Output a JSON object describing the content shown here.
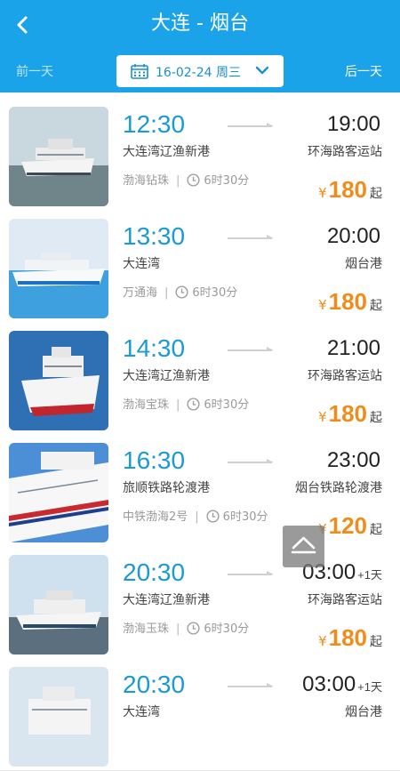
{
  "header": {
    "title": "大连 - 烟台",
    "prev_day": "前一天",
    "next_day": "后一天",
    "date": "16-02-24 周三"
  },
  "colors": {
    "brand": "#1aa3e8",
    "time": "#1a9ad6",
    "price": "#f08c1b"
  },
  "sailings": [
    {
      "depart": "12:30",
      "from": "大连湾辽渔新港",
      "ship": "渤海钻珠",
      "duration": "6时30分",
      "arrive": "19:00",
      "next_day": "",
      "to": "环海路客运站",
      "currency": "¥",
      "price": "180",
      "price_suffix": "起"
    },
    {
      "depart": "13:30",
      "from": "大连湾",
      "ship": "万通海",
      "duration": "6时30分",
      "arrive": "20:00",
      "next_day": "",
      "to": "烟台港",
      "currency": "¥",
      "price": "180",
      "price_suffix": "起"
    },
    {
      "depart": "14:30",
      "from": "大连湾辽渔新港",
      "ship": "渤海宝珠",
      "duration": "6时30分",
      "arrive": "21:00",
      "next_day": "",
      "to": "环海路客运站",
      "currency": "¥",
      "price": "180",
      "price_suffix": "起"
    },
    {
      "depart": "16:30",
      "from": "旅顺铁路轮渡港",
      "ship": "中铁渤海2号",
      "duration": "6时30分",
      "arrive": "23:00",
      "next_day": "",
      "to": "烟台铁路轮渡港",
      "currency": "¥",
      "price": "120",
      "price_suffix": "起"
    },
    {
      "depart": "20:30",
      "from": "大连湾辽渔新港",
      "ship": "渤海玉珠",
      "duration": "6时30分",
      "arrive": "03:00",
      "next_day": "+1天",
      "to": "环海路客运站",
      "currency": "¥",
      "price": "180",
      "price_suffix": "起"
    },
    {
      "depart": "20:30",
      "from": "大连湾",
      "ship": "",
      "duration": "",
      "arrive": "03:00",
      "next_day": "+1天",
      "to": "烟台港",
      "currency": "",
      "price": "",
      "price_suffix": ""
    }
  ]
}
